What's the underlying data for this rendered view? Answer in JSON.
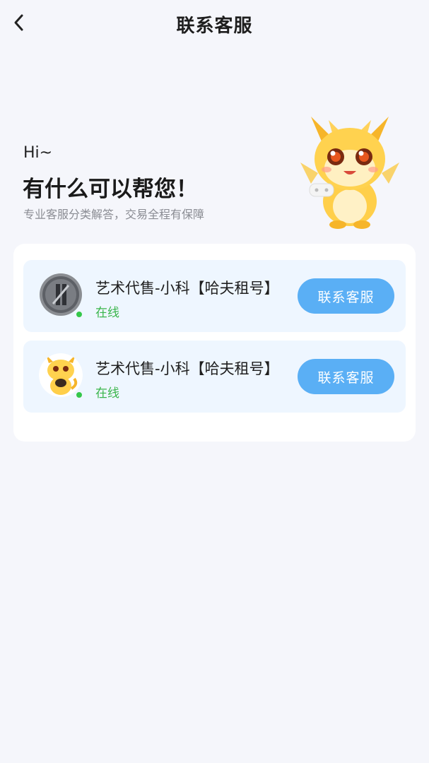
{
  "header": {
    "title": "联系客服",
    "back_icon": "chevron-left-icon"
  },
  "hero": {
    "greeting": "Hi~",
    "headline": "有什么可以帮您！",
    "subline": "专业客服分类解答，交易全程有保障",
    "mascot": "dragon-mascot"
  },
  "agents": [
    {
      "name": "艺术代售-小科【哈夫租号】",
      "status": "在线",
      "button_label": "联系客服",
      "avatar": "silver-coin-avatar"
    },
    {
      "name": "艺术代售-小科【哈夫租号】",
      "status": "在线",
      "button_label": "联系客服",
      "avatar": "dragon-avatar"
    }
  ],
  "colors": {
    "background": "#f5f6fb",
    "row_background": "#eef6ff",
    "button": "#5aaff5",
    "online": "#39b54a"
  }
}
